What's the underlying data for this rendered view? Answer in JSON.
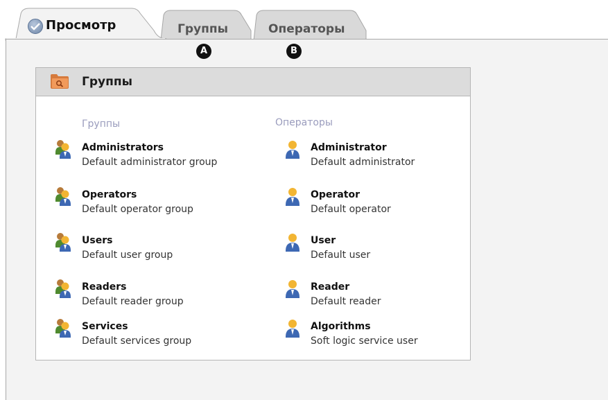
{
  "tabs": [
    {
      "label": "Просмотр",
      "active": true,
      "icon": "check-circle-icon"
    },
    {
      "label": "Группы",
      "badge": "A"
    },
    {
      "label": "Операторы",
      "badge": "B"
    }
  ],
  "panel": {
    "title": "Группы",
    "icon": "folder-search-icon",
    "groups_header": "Группы",
    "operators_header": "Операторы",
    "groups": [
      {
        "name": "Administrators",
        "desc": "Default administrator group"
      },
      {
        "name": "Operators",
        "desc": "Default operator group"
      },
      {
        "name": "Users",
        "desc": "Default user group"
      },
      {
        "name": "Readers",
        "desc": "Default reader group"
      },
      {
        "name": "Services",
        "desc": "Default services group"
      }
    ],
    "operators": [
      {
        "name": "Administrator",
        "desc": "Default administrator"
      },
      {
        "name": "Operator",
        "desc": "Default operator"
      },
      {
        "name": "User",
        "desc": "Default user"
      },
      {
        "name": "Reader",
        "desc": "Default reader"
      },
      {
        "name": "Algorithms",
        "desc": "Soft logic service user"
      }
    ]
  },
  "colors": {
    "tab_bg": "#f3f3f3",
    "tab_inactive": "#d8d8d8",
    "header_bg": "#dcdcdc",
    "column_header": "#9a9cbd"
  }
}
